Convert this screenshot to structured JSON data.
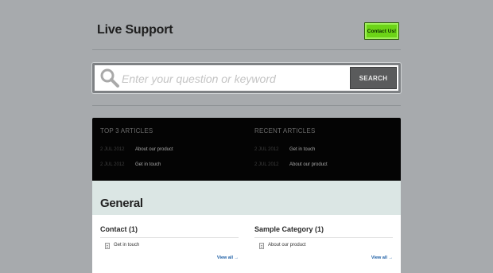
{
  "header": {
    "brand": "Live Support",
    "contact_label": "Contact Us!"
  },
  "search": {
    "placeholder": "Enter your question or keyword",
    "button_label": "SEARCH"
  },
  "articles": {
    "top": {
      "title": "TOP 3 ARTICLES",
      "items": [
        {
          "date": "2 JUL 2012",
          "label": "About our product"
        },
        {
          "date": "2 JUL 2012",
          "label": "Get in touch"
        }
      ]
    },
    "recent": {
      "title": "RECENT ARTICLES",
      "items": [
        {
          "date": "2 JUL 2012",
          "label": "Get in touch"
        },
        {
          "date": "2 JUL 2012",
          "label": "About our product"
        }
      ]
    }
  },
  "main": {
    "section_title": "General",
    "categories": [
      {
        "title": "Contact (1)",
        "items": [
          {
            "label": "Get in touch"
          }
        ],
        "view_all": "View all →"
      },
      {
        "title": "Sample Category (1)",
        "items": [
          {
            "label": "About our product"
          }
        ],
        "view_all": "View all →"
      }
    ]
  },
  "colors": {
    "background": "#a7aaad",
    "accent_button": "#6cd417",
    "article_panel": "#040404",
    "section_band": "#dbe6e4",
    "link": "#1c5ea5"
  }
}
